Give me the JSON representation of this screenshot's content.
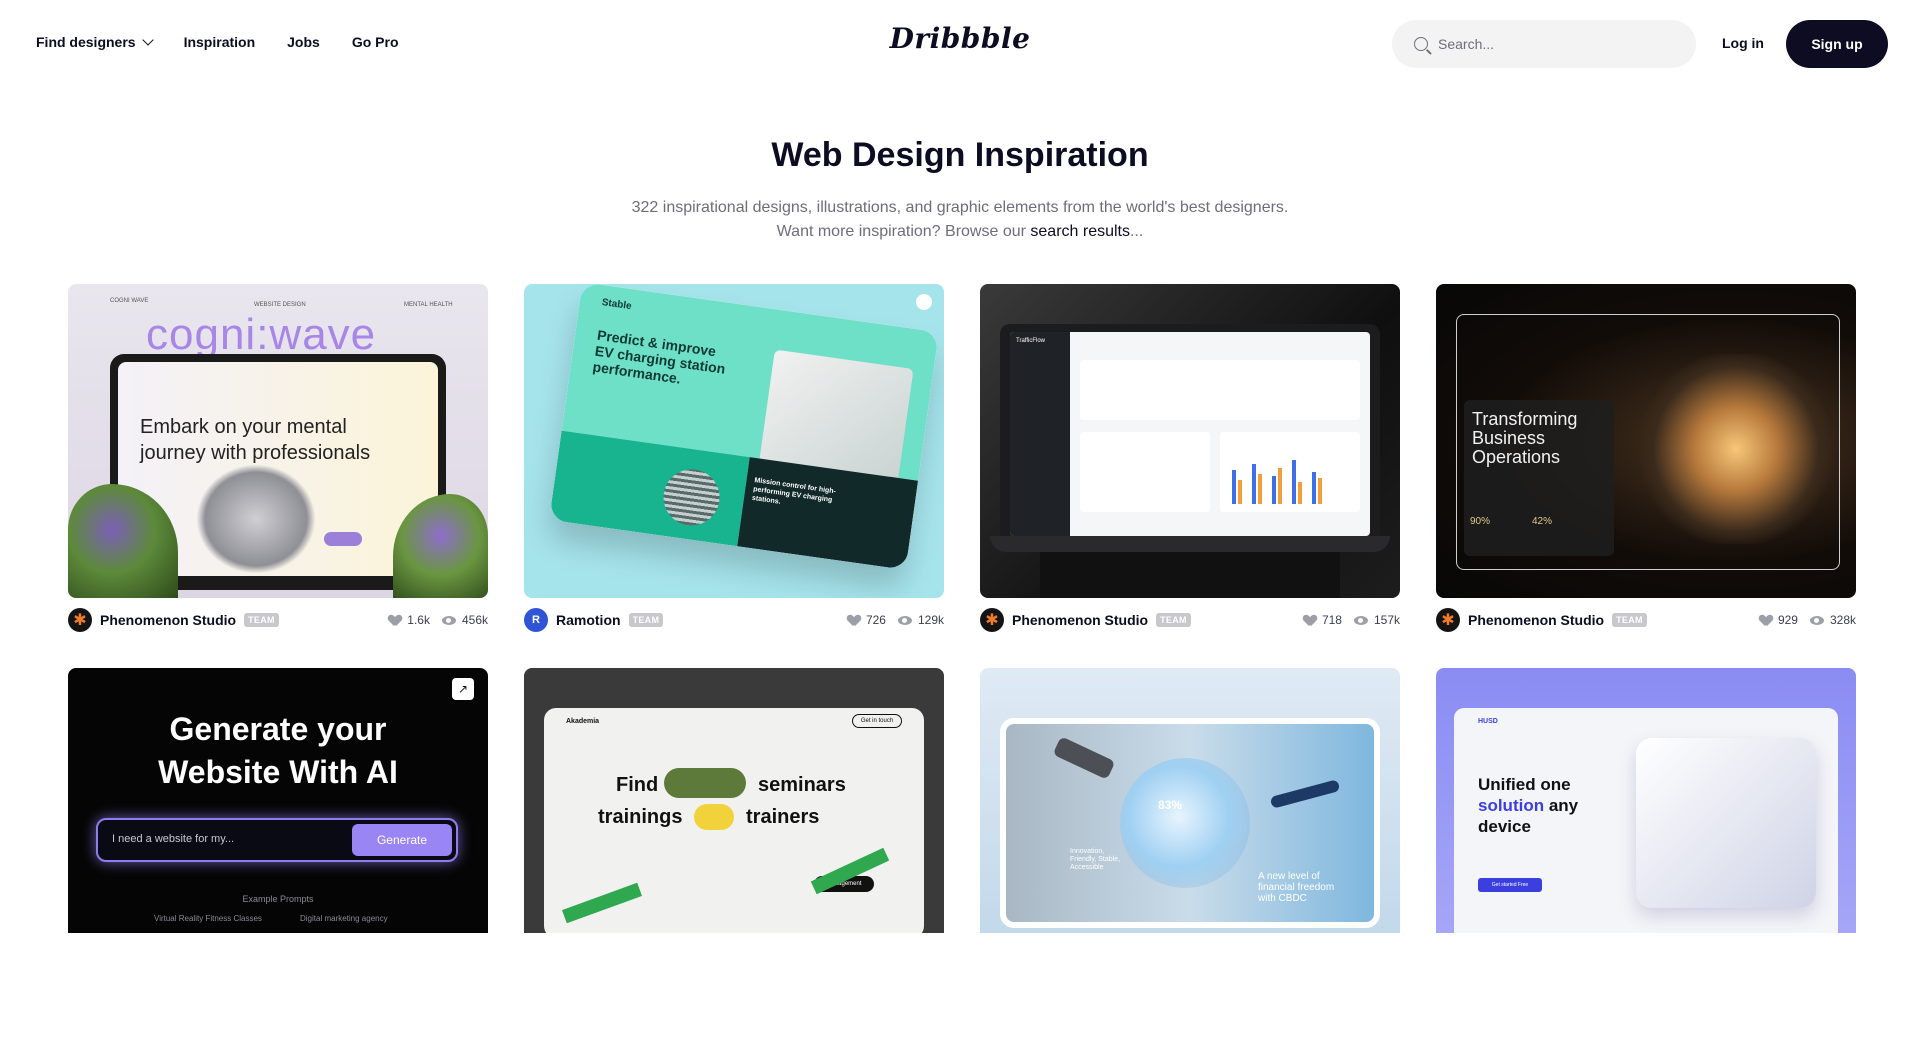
{
  "nav": {
    "items": [
      "Find designers",
      "Inspiration",
      "Jobs",
      "Go Pro"
    ],
    "logo": "Dribbble",
    "search_placeholder": "Search...",
    "login": "Log in",
    "signup": "Sign up"
  },
  "hero": {
    "title": "Web Design Inspiration",
    "line1": "322 inspirational designs, illustrations, and graphic elements from the world's best designers.",
    "line2_prefix": "Want more inspiration? Browse our ",
    "line2_link": "search results",
    "line2_suffix": "..."
  },
  "shots": [
    {
      "author": "Phenomenon Studio",
      "badge": "TEAM",
      "likes": "1.6k",
      "views": "456k",
      "art": {
        "top_left": "COGNI WAVE",
        "top_mid": "WEBSITE DESIGN",
        "top_right": "MENTAL HEALTH",
        "brand": "cogni:wave",
        "headline1": "Embark on your mental",
        "headline2": "journey with professionals"
      }
    },
    {
      "author": "Ramotion",
      "badge": "TEAM",
      "likes": "726",
      "views": "129k",
      "art": {
        "brand": "Stable",
        "headline1": "Predict & improve",
        "headline2": "EV charging station",
        "headline3": "performance.",
        "bottom": "Mission control for high-performing EV charging stations."
      }
    },
    {
      "author": "Phenomenon Studio",
      "badge": "TEAM",
      "likes": "718",
      "views": "157k",
      "art": {
        "brand": "TrafficFlow"
      }
    },
    {
      "author": "Phenomenon Studio",
      "badge": "TEAM",
      "likes": "929",
      "views": "328k",
      "art": {
        "headline1": "Transforming",
        "headline2": "Business",
        "headline3": "Operations",
        "stat1": "90%",
        "stat2": "42%"
      }
    },
    {
      "author": "",
      "badge": "",
      "likes": "",
      "views": "",
      "art": {
        "headline1": "Generate your",
        "headline2": "Website With AI",
        "input_placeholder": "I need a website for my...",
        "button": "Generate",
        "prompts_label": "Example Prompts",
        "prompt1": "Virtual Reality Fitness Classes",
        "prompt2": "Digital marketing agency"
      }
    },
    {
      "author": "",
      "badge": "",
      "likes": "",
      "views": "",
      "art": {
        "brand": "Akademia",
        "headline1": "Find",
        "headline1b": "seminars",
        "headline2": "trainings",
        "headline2b": "trainers",
        "tag": "Management",
        "cta": "Get in touch"
      }
    },
    {
      "author": "",
      "badge": "",
      "likes": "",
      "views": "",
      "art": {
        "stat": "83%",
        "caption1": "Innovation,",
        "caption2": "Friendly, Stable,",
        "caption3": "Accessible",
        "headline1": "A new level of",
        "headline2": "financial freedom",
        "headline3": "with CBDC"
      }
    },
    {
      "author": "",
      "badge": "",
      "likes": "",
      "views": "",
      "art": {
        "brand": "HUSD",
        "headline1": "Unified one",
        "headline2a": "solution",
        "headline2b": " any",
        "headline3": "device",
        "cta": "Get started Free"
      }
    }
  ],
  "colors": {
    "ink": "#0d0c22",
    "muted": "#6e6d7a",
    "badge": "#c7c7cc"
  }
}
